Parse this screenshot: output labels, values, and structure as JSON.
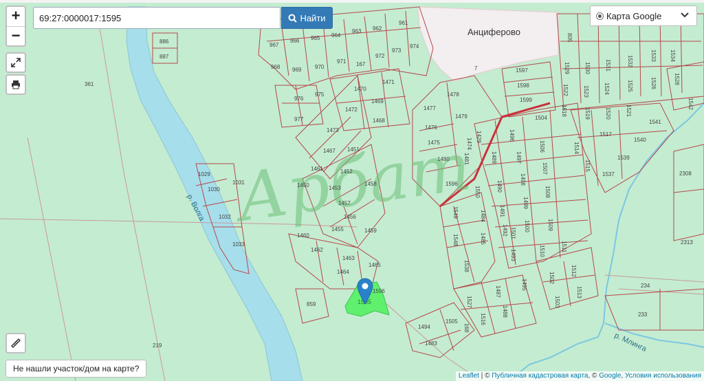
{
  "search": {
    "value": "69:27:0000017:1595",
    "button_label": "Найти"
  },
  "zoom": {
    "in_label": "+",
    "out_label": "−"
  },
  "layer_select": {
    "selected": "Карта Google"
  },
  "not_found_button": "Не нашли участок/дом на карте?",
  "attribution": {
    "leaflet": "Leaflet",
    "sep1": " | © ",
    "cadastral": "Публичная кадастровая карта",
    "sep2": ", © ",
    "google": "Google",
    "sep3": ", ",
    "terms": "Условия использования"
  },
  "colors": {
    "land": "#c4ecd1",
    "river": "#a6dfeb",
    "parcel_line": "#b5474a",
    "highlight": "#5ff06e",
    "marker": "#2a82cb",
    "village": "#f3eef0"
  },
  "map": {
    "village_label": "Анциферово",
    "river_volga_label": "р. Волга",
    "river_mlinga_label": "р. Млинга",
    "watermark": "Арбат",
    "selected_parcel_label": "1595",
    "parcel_labels": [
      "886",
      "887",
      "361",
      "1029",
      "1030",
      "1031",
      "1032",
      "1033",
      "219",
      "967",
      "966",
      "965",
      "964",
      "963",
      "962",
      "961",
      "974",
      "968",
      "969",
      "970",
      "971",
      "167",
      "972",
      "973",
      "976",
      "975",
      "977",
      "1470",
      "1471",
      "1472",
      "1469",
      "1473",
      "1468",
      "1467",
      "1451",
      "1461",
      "1452",
      "1450",
      "1453",
      "1458",
      "1457",
      "1456",
      "1455",
      "1459",
      "1460",
      "1462",
      "1463",
      "1464",
      "1465",
      "1596",
      "859",
      "1477",
      "1478",
      "1476",
      "1479",
      "1475",
      "1474",
      "1480",
      "1481",
      "1429",
      "1596",
      "1597",
      "1598",
      "1599",
      "1496",
      "1504",
      "1489",
      "1497",
      "1506",
      "1490",
      "1498",
      "1507",
      "1550",
      "1491",
      "1499",
      "1508",
      "1549",
      "1484",
      "1492",
      "1500",
      "1509",
      "1548",
      "1485",
      "1501",
      "1510",
      "1538",
      "1493",
      "1511",
      "1502",
      "1512",
      "1487",
      "1495",
      "1503",
      "1513",
      "1527",
      "1488",
      "1516",
      "168",
      "1505",
      "1494",
      "1483",
      "805",
      "1529",
      "1530",
      "1531",
      "1532",
      "1533",
      "1534",
      "1522",
      "1523",
      "1524",
      "1525",
      "1526",
      "1528",
      "1518",
      "1519",
      "1520",
      "1521",
      "1542",
      "1541",
      "1514",
      "1517",
      "1540",
      "1515",
      "1539",
      "1537",
      "2308",
      "2313",
      "234",
      "233",
      "7"
    ]
  }
}
